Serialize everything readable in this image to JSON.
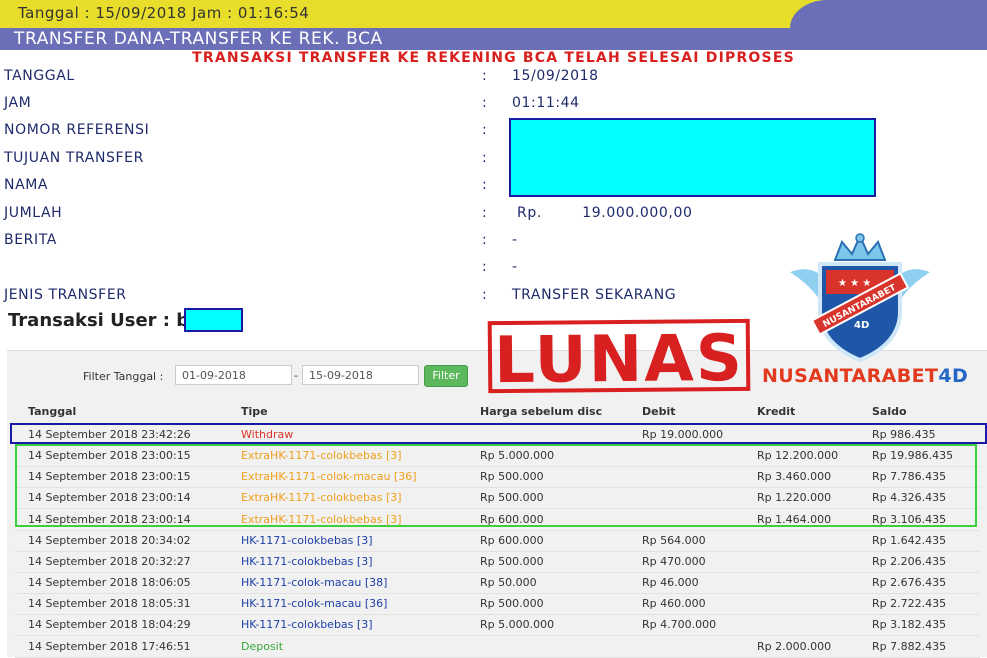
{
  "header": {
    "datetime": "Tanggal : 15/09/2018 Jam : 01:16:54",
    "title": "TRANSFER DANA-TRANSFER KE REK. BCA",
    "status": "TRANSAKSI TRANSFER KE REKENING BCA TELAH SELESAI DIPROSES"
  },
  "receipt": {
    "colon": ":",
    "rows": [
      {
        "label": "TANGGAL",
        "value": "15/09/2018"
      },
      {
        "label": "JAM",
        "value": "01:11:44"
      },
      {
        "label": "NOMOR REFERENSI",
        "value": ""
      },
      {
        "label": "TUJUAN TRANSFER",
        "value": ""
      },
      {
        "label": "NAMA",
        "value": ""
      },
      {
        "label": "JUMLAH",
        "value": "Rp.        19.000.000,00"
      },
      {
        "label": "BERITA",
        "value": "-"
      },
      {
        "label": "",
        "value": "-"
      },
      {
        "label": "JENIS TRANSFER",
        "value": "TRANSFER SEKARANG"
      }
    ]
  },
  "section": {
    "title": "Transaksi User : b"
  },
  "filter": {
    "label": "Filter Tanggal :",
    "from": "01-09-2018",
    "separator": "-",
    "to": "15-09-2018",
    "button": "Filter"
  },
  "table": {
    "headers": [
      "Tanggal",
      "Tipe",
      "Harga sebelum disc",
      "Debit",
      "Kredit",
      "Saldo"
    ],
    "rows": [
      {
        "tanggal": "14 September 2018 23:42:26",
        "tipe": "Withdraw",
        "harga": "",
        "debit": "Rp 19.000.000",
        "kredit": "",
        "saldo": "Rp 986.435"
      },
      {
        "tanggal": "14 September 2018 23:00:15",
        "tipe_prefix": "Extra",
        "tipe": "HK-1171-colokbebas [3]",
        "harga": "Rp 5.000.000",
        "debit": "",
        "kredit": "Rp 12.200.000",
        "saldo": "Rp 19.986.435"
      },
      {
        "tanggal": "14 September 2018 23:00:15",
        "tipe_prefix": "Extra",
        "tipe": "HK-1171-colok-macau [36]",
        "harga": "Rp 500.000",
        "debit": "",
        "kredit": "Rp 3.460.000",
        "saldo": "Rp 7.786.435"
      },
      {
        "tanggal": "14 September 2018 23:00:14",
        "tipe_prefix": "Extra",
        "tipe": "HK-1171-colokbebas [3]",
        "harga": "Rp 500.000",
        "debit": "",
        "kredit": "Rp 1.220.000",
        "saldo": "Rp 4.326.435"
      },
      {
        "tanggal": "14 September 2018 23:00:14",
        "tipe_prefix": "Extra",
        "tipe": "HK-1171-colokbebas [3]",
        "harga": "Rp 600.000",
        "debit": "",
        "kredit": "Rp 1.464.000",
        "saldo": "Rp 3.106.435"
      },
      {
        "tanggal": "14 September 2018 20:34:02",
        "tipe": "HK-1171-colokbebas [3]",
        "harga": "Rp 600.000",
        "debit": "Rp 564.000",
        "kredit": "",
        "saldo": "Rp 1.642.435"
      },
      {
        "tanggal": "14 September 2018 20:32:27",
        "tipe": "HK-1171-colokbebas [3]",
        "harga": "Rp 500.000",
        "debit": "Rp 470.000",
        "kredit": "",
        "saldo": "Rp 2.206.435"
      },
      {
        "tanggal": "14 September 2018 18:06:05",
        "tipe": "HK-1171-colok-macau [38]",
        "harga": "Rp 50.000",
        "debit": "Rp 46.000",
        "kredit": "",
        "saldo": "Rp 2.676.435"
      },
      {
        "tanggal": "14 September 2018 18:05:31",
        "tipe": "HK-1171-colok-macau [36]",
        "harga": "Rp 500.000",
        "debit": "Rp 460.000",
        "kredit": "",
        "saldo": "Rp 2.722.435"
      },
      {
        "tanggal": "14 September 2018 18:04:29",
        "tipe": "HK-1171-colokbebas [3]",
        "harga": "Rp 5.000.000",
        "debit": "Rp 4.700.000",
        "kredit": "",
        "saldo": "Rp 3.182.435"
      },
      {
        "tanggal": "14 September 2018 17:46:51",
        "tipe": "Deposit",
        "harga": "",
        "debit": "",
        "kredit": "Rp 2.000.000",
        "saldo": "Rp 7.882.435"
      }
    ]
  },
  "stamp": {
    "text": "LUNAS"
  },
  "brand": {
    "name": "NUSANTARABET",
    "suffix": "4D",
    "logo_text": "NUSANTARABET",
    "logo_sub": "4D"
  },
  "colors": {
    "header_yellow": "#e8dd2a",
    "header_purple": "#6b6fb8",
    "status_red": "#d8201f",
    "redact_cyan": "#00ffff",
    "highlight_blue": "#1a1aa8",
    "highlight_green": "#3cd13c"
  }
}
